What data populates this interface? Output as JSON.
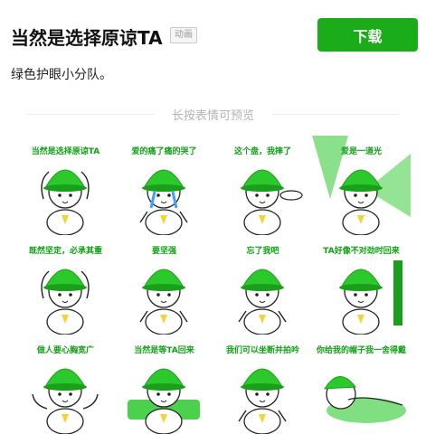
{
  "app": {
    "title": "当然是选择原谅TA",
    "badge": "动画",
    "download_label": "下载",
    "description": "绿色护眼小分队。",
    "preview_hint": "长按表情可预览"
  },
  "colors": {
    "accent": "#1aac19",
    "hat": "#2bc92b",
    "hat_dark": "#1b9e1b",
    "caption": "#10a014"
  },
  "stickers": [
    {
      "caption": "当然是选择原谅TA",
      "icon": "sticker-raise-arms"
    },
    {
      "caption": "爱的痛了痛的哭了",
      "icon": "sticker-crying-mic"
    },
    {
      "caption": "这个盘，我摔了",
      "icon": "sticker-plate"
    },
    {
      "caption": "爱是一道光",
      "icon": "sticker-light"
    },
    {
      "caption": "既然坚定，必承其重",
      "icon": "sticker-hands-up"
    },
    {
      "caption": "要坚强",
      "icon": "sticker-strong"
    },
    {
      "caption": "忘了我吧",
      "icon": "sticker-forget"
    },
    {
      "caption": "TA好像不对劲时回来",
      "icon": "sticker-door"
    },
    {
      "caption": "做人要心胸宽广",
      "icon": "sticker-open-arms"
    },
    {
      "caption": "当然是等TA回来",
      "icon": "sticker-sofa"
    },
    {
      "caption": "我们可以坐断并拍吟",
      "icon": "sticker-walk"
    },
    {
      "caption": "你给我的帽子我一舍得戴",
      "icon": "sticker-sleep"
    }
  ]
}
